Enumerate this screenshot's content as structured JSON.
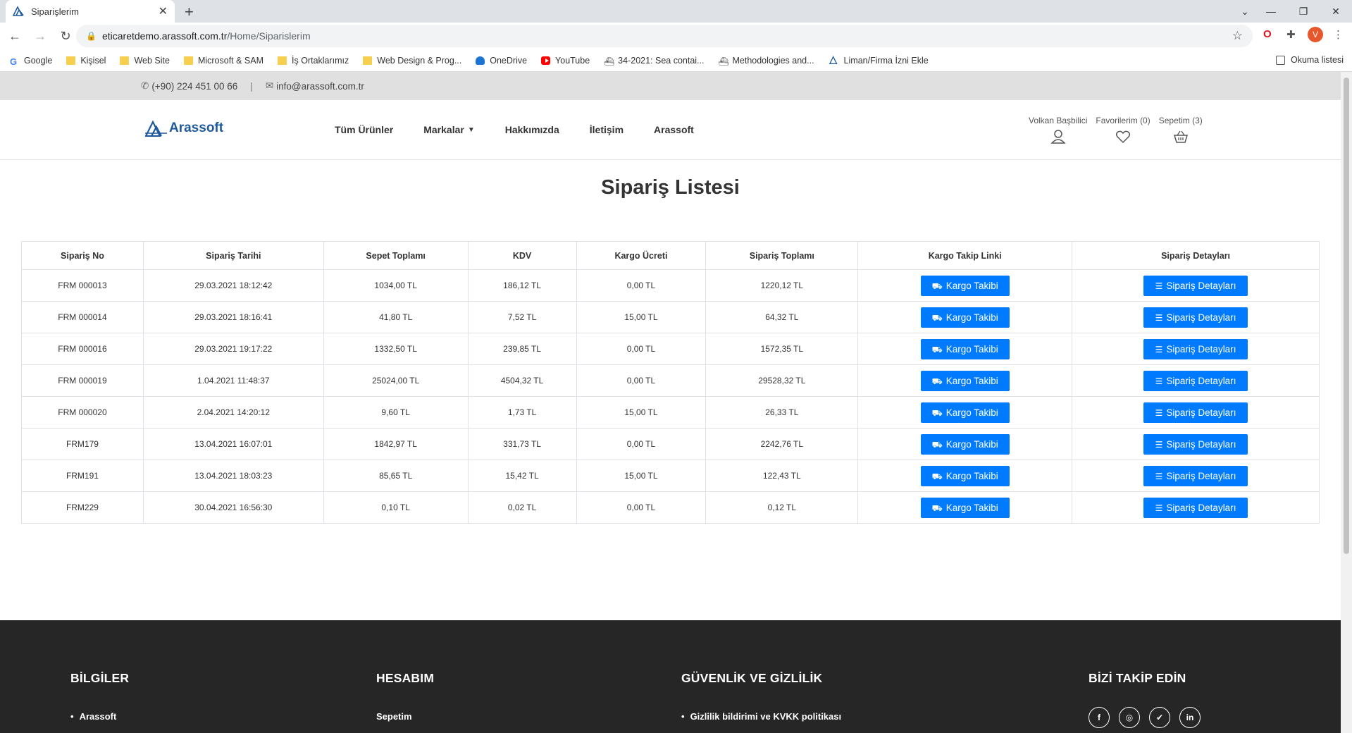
{
  "browser": {
    "tab_title": "Siparişlerim",
    "url_host": "eticaretdemo.arassoft.com.tr",
    "url_path": "/Home/Siparislerim",
    "avatar_letter": "V",
    "bookmarks": [
      "Google",
      "Kişisel",
      "Web Site",
      "Microsoft & SAM",
      "İş Ortaklarımız",
      "Web Design & Prog...",
      "OneDrive",
      "YouTube",
      "34-2021: Sea contai...",
      "Methodologies and...",
      "Liman/Firma İzni Ekle"
    ],
    "reading_list": "Okuma listesi"
  },
  "topbar": {
    "phone": "(+90) 224 451 00 66",
    "separator": "|",
    "email": "info@arassoft.com.tr"
  },
  "header": {
    "logo_text": "Arassoft",
    "nav": [
      "Tüm Ürünler",
      "Markalar",
      "Hakkımızda",
      "İletişim",
      "Arassoft"
    ],
    "user": "Volkan Başbilici",
    "favorites": "Favorilerim (0)",
    "cart": "Sepetim (3)"
  },
  "page_title": "Sipariş Listesi",
  "table": {
    "headers": [
      "Sipariş No",
      "Sipariş Tarihi",
      "Sepet Toplamı",
      "KDV",
      "Kargo Ücreti",
      "Sipariş Toplamı",
      "Kargo Takip Linki",
      "Sipariş Detayları"
    ],
    "kargo_button": "Kargo Takibi",
    "detay_button": "Sipariş Detayları",
    "rows": [
      [
        "FRM 000013",
        "29.03.2021 18:12:42",
        "1034,00 TL",
        "186,12 TL",
        "0,00 TL",
        "1220,12 TL"
      ],
      [
        "FRM 000014",
        "29.03.2021 18:16:41",
        "41,80 TL",
        "7,52 TL",
        "15,00 TL",
        "64,32 TL"
      ],
      [
        "FRM 000016",
        "29.03.2021 19:17:22",
        "1332,50 TL",
        "239,85 TL",
        "0,00 TL",
        "1572,35 TL"
      ],
      [
        "FRM 000019",
        "1.04.2021 11:48:37",
        "25024,00 TL",
        "4504,32 TL",
        "0,00 TL",
        "29528,32 TL"
      ],
      [
        "FRM 000020",
        "2.04.2021 14:20:12",
        "9,60 TL",
        "1,73 TL",
        "15,00 TL",
        "26,33 TL"
      ],
      [
        "FRM179",
        "13.04.2021 16:07:01",
        "1842,97 TL",
        "331,73 TL",
        "0,00 TL",
        "2242,76 TL"
      ],
      [
        "FRM191",
        "13.04.2021 18:03:23",
        "85,65 TL",
        "15,42 TL",
        "15,00 TL",
        "122,43 TL"
      ],
      [
        "FRM229",
        "30.04.2021 16:56:30",
        "0,10 TL",
        "0,02 TL",
        "0,00 TL",
        "0,12 TL"
      ]
    ]
  },
  "footer": {
    "bilgiler": {
      "title": "BİLGİLER",
      "items": [
        "Arassoft"
      ]
    },
    "hesabim": {
      "title": "HESABIM",
      "items": [
        "Sepetim"
      ]
    },
    "guvenlik": {
      "title": "GÜVENLİK VE GİZLİLİK",
      "items": [
        "Gizlilik bildirimi ve KVKK politikası"
      ]
    },
    "takip": {
      "title": "BİZİ TAKİP EDİN",
      "icons": [
        "facebook-icon",
        "instagram-icon",
        "twitter-icon",
        "linkedin-icon"
      ]
    }
  },
  "colors": {
    "button_blue": "#007bff",
    "footer_bg": "#262626",
    "topbar_bg": "#e0e0e0",
    "logo_blue": "#1f5a9c"
  }
}
